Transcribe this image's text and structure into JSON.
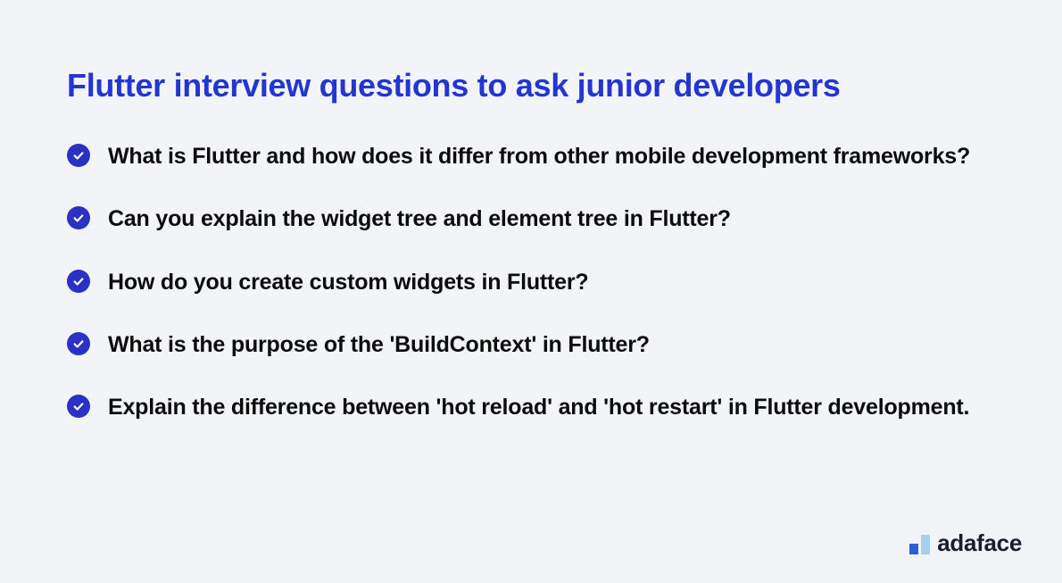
{
  "title": "Flutter interview questions to ask junior developers",
  "questions": [
    "What is Flutter and how does it differ from other mobile development frameworks?",
    "Can you explain the widget tree and element tree in Flutter?",
    "How do you create custom widgets in Flutter?",
    "What is the purpose of the 'BuildContext' in Flutter?",
    "Explain the difference between 'hot reload' and 'hot restart' in Flutter development."
  ],
  "brand": "adaface"
}
